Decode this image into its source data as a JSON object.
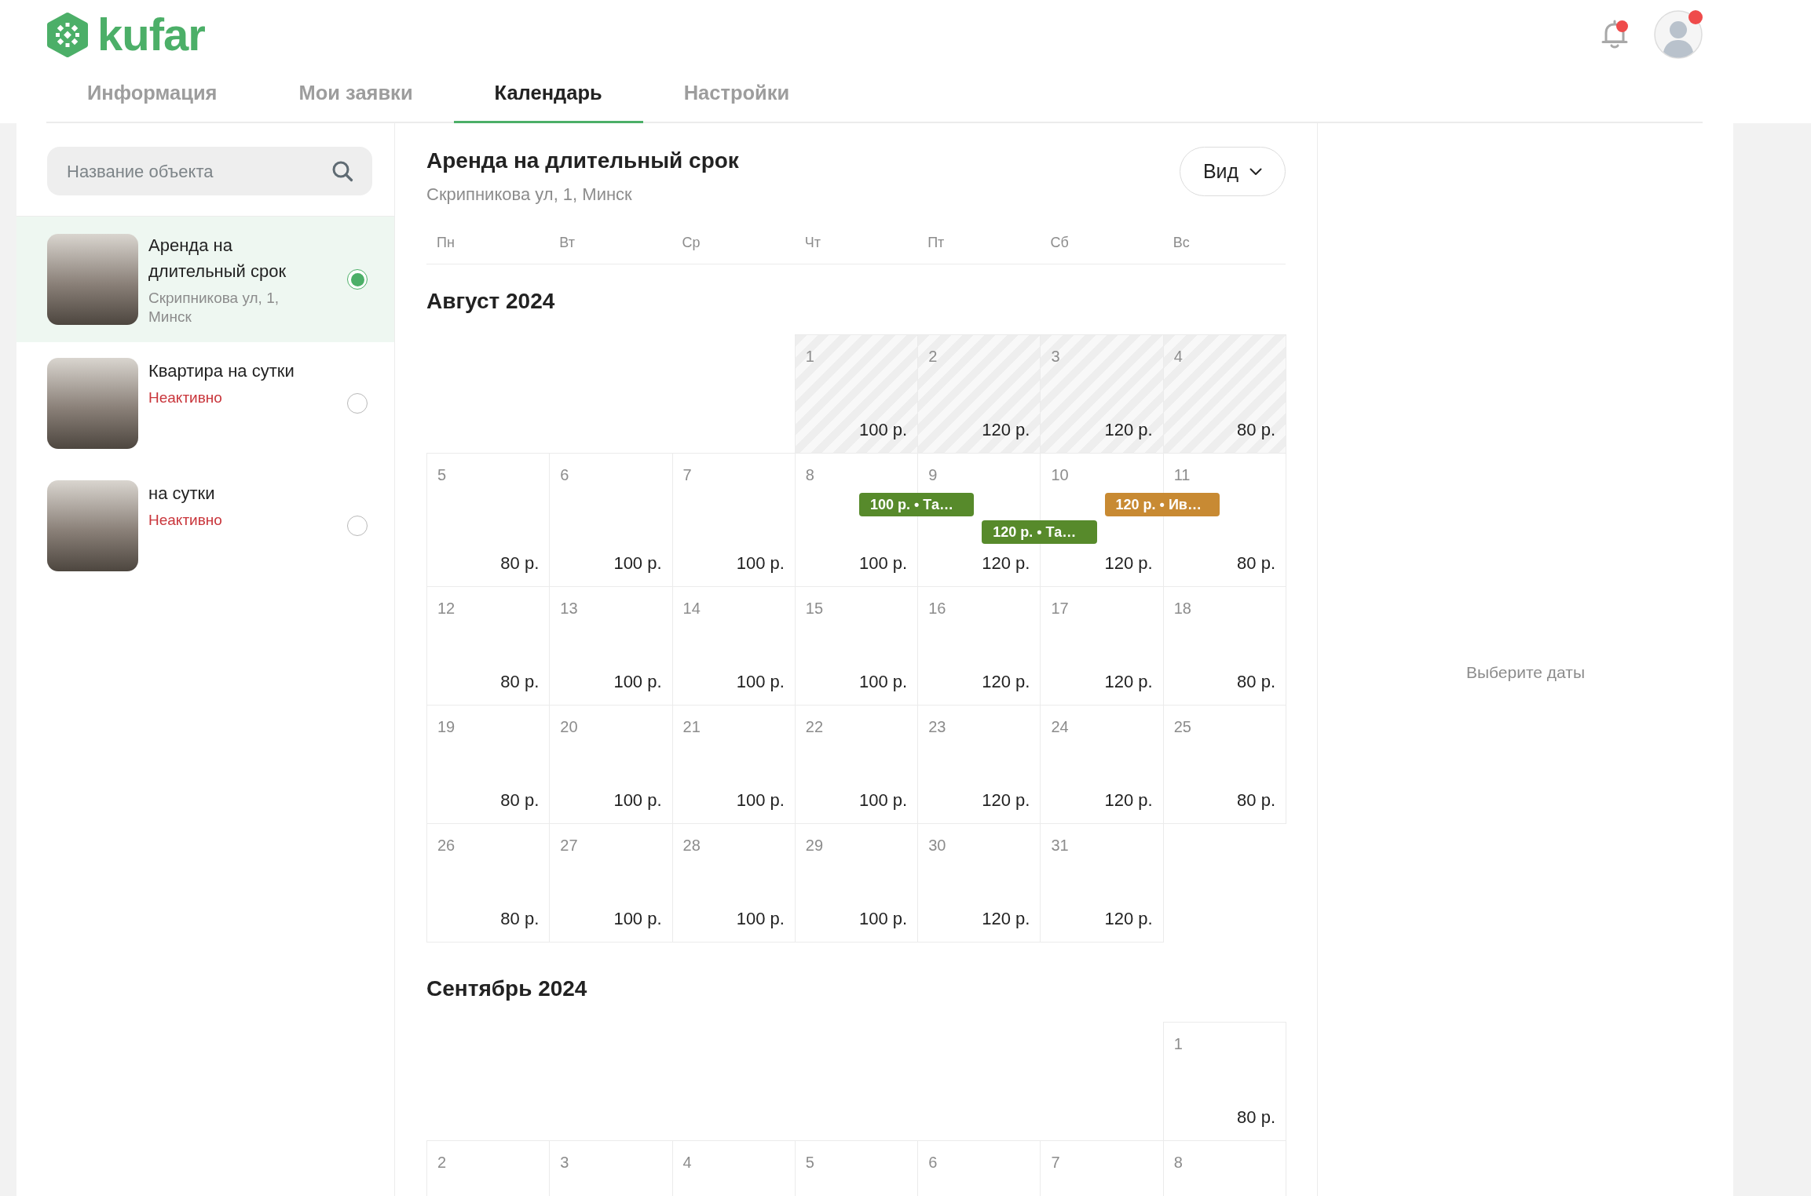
{
  "header": {
    "logo": "kufar",
    "bell": {
      "badge": true
    },
    "avatar": {
      "badge": true
    },
    "tabs": [
      {
        "label": "Информация",
        "selected": false
      },
      {
        "label": "Мои заявки",
        "selected": false
      },
      {
        "label": "Календарь",
        "selected": true
      },
      {
        "label": "Настройки",
        "selected": false
      }
    ]
  },
  "sidebar": {
    "search": {
      "placeholder": "Название объекта"
    },
    "items": [
      {
        "title": "Аренда на длительный срок",
        "address": "Скрипникова ул, 1, Минск",
        "selected": true
      },
      {
        "title": "Квартира на сутки",
        "status": "Неактивно",
        "selected": false
      },
      {
        "title": "на сутки",
        "status": "Неактивно",
        "selected": false
      }
    ]
  },
  "calendar": {
    "title": "Аренда на длительный срок",
    "address": "Скрипникова ул, 1, Минск",
    "view_button": "Вид",
    "weekdays": [
      "Пн",
      "Вт",
      "Ср",
      "Чт",
      "Пт",
      "Сб",
      "Вс"
    ],
    "months": [
      {
        "title": "Август 2024",
        "weeks": [
          [
            {
              "day": "1",
              "price": "100 р.",
              "unavailable": true
            },
            {
              "day": "2",
              "price": "120 р.",
              "unavailable": true
            },
            {
              "day": "3",
              "price": "120 р.",
              "unavailable": true
            },
            {
              "day": "4",
              "price": "80 р.",
              "unavailable": true
            }
          ],
          [
            {
              "day": "5",
              "price": "80 р.",
              "unavailable": false
            },
            {
              "day": "6",
              "price": "100 р.",
              "unavailable": false
            },
            {
              "day": "7",
              "price": "100 р.",
              "unavailable": false
            },
            {
              "day": "8",
              "price": "100 р.",
              "unavailable": false,
              "booking": {
                "label": "100 р. • Та…",
                "color": "#578a2b"
              }
            },
            {
              "day": "9",
              "price": "120 р.",
              "unavailable": false,
              "booking": {
                "label": "120 р. • Та…",
                "color": "#578a2b"
              }
            },
            {
              "day": "10",
              "price": "120 р.",
              "unavailable": false,
              "booking": {
                "label": "120 р. • Ив…",
                "color": "#c88a33"
              }
            },
            {
              "day": "11",
              "price": "80 р.",
              "unavailable": false
            }
          ],
          [
            {
              "day": "12",
              "price": "80 р.",
              "unavailable": false
            },
            {
              "day": "13",
              "price": "100 р.",
              "unavailable": false
            },
            {
              "day": "14",
              "price": "100 р.",
              "unavailable": false
            },
            {
              "day": "15",
              "price": "100 р.",
              "unavailable": false
            },
            {
              "day": "16",
              "price": "120 р.",
              "unavailable": false
            },
            {
              "day": "17",
              "price": "120 р.",
              "unavailable": false
            },
            {
              "day": "18",
              "price": "80 р.",
              "unavailable": false
            }
          ],
          [
            {
              "day": "19",
              "price": "80 р.",
              "unavailable": false
            },
            {
              "day": "20",
              "price": "100 р.",
              "unavailable": false
            },
            {
              "day": "21",
              "price": "100 р.",
              "unavailable": false
            },
            {
              "day": "22",
              "price": "100 р.",
              "unavailable": false
            },
            {
              "day": "23",
              "price": "120 р.",
              "unavailable": false
            },
            {
              "day": "24",
              "price": "120 р.",
              "unavailable": false
            },
            {
              "day": "25",
              "price": "80 р.",
              "unavailable": false
            }
          ],
          [
            {
              "day": "26",
              "price": "80 р.",
              "unavailable": false
            },
            {
              "day": "27",
              "price": "100 р.",
              "unavailable": false
            },
            {
              "day": "28",
              "price": "100 р.",
              "unavailable": false
            },
            {
              "day": "29",
              "price": "100 р.",
              "unavailable": false
            },
            {
              "day": "30",
              "price": "120 р.",
              "unavailable": false
            },
            {
              "day": "31",
              "price": "120 р.",
              "unavailable": false
            }
          ]
        ]
      },
      {
        "title": "Сентябрь 2024",
        "weeks": [
          [
            {
              "day": "1",
              "price": "80 р.",
              "unavailable": false
            }
          ],
          [
            {
              "day": "2",
              "unavailable": false
            },
            {
              "day": "3",
              "unavailable": false
            },
            {
              "day": "4",
              "unavailable": false
            },
            {
              "day": "5",
              "unavailable": false
            },
            {
              "day": "6",
              "unavailable": false
            },
            {
              "day": "7",
              "unavailable": false
            },
            {
              "day": "8",
              "unavailable": false
            }
          ]
        ]
      }
    ]
  },
  "details_panel": {
    "hint": "Выберите даты"
  }
}
